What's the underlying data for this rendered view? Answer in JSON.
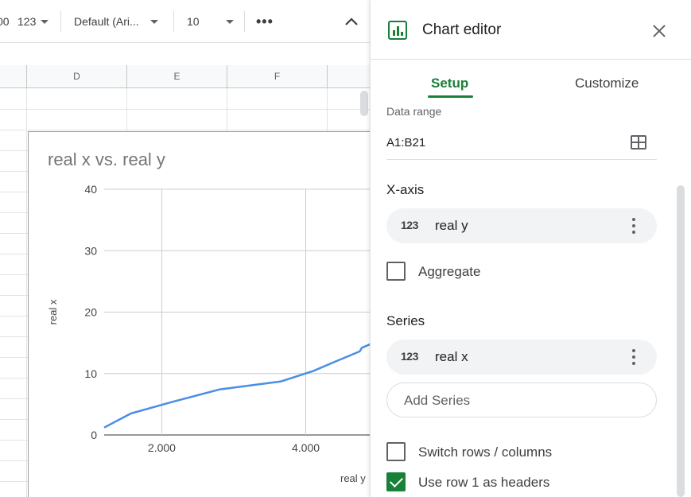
{
  "toolbar": {
    "format_partial": "00",
    "number_format": "123",
    "font": "Default (Ari...",
    "font_size": "10",
    "more_icon": "more-horizontal-icon",
    "collapse_icon": "chevron-up-icon"
  },
  "sheet": {
    "columns": [
      "D",
      "E",
      "F"
    ]
  },
  "chart_data": {
    "type": "line",
    "title": "real x vs. real y",
    "xlabel": "real y",
    "ylabel": "real x",
    "xlim": [
      1.2,
      4.9
    ],
    "ylim": [
      0,
      40
    ],
    "x_ticks": [
      "2.000",
      "4.000"
    ],
    "y_ticks": [
      "0",
      "10",
      "20",
      "30",
      "40"
    ],
    "grid": true,
    "color": "#4a8ee6",
    "series": [
      {
        "x": [
          1.2,
          1.57,
          2.15,
          2.8,
          3.65,
          4.1,
          4.4,
          4.75,
          4.78,
          4.9
        ],
        "values": [
          1.2,
          3.5,
          5.4,
          7.4,
          8.7,
          10.4,
          11.9,
          13.6,
          14.2,
          14.8
        ]
      }
    ]
  },
  "editor": {
    "title": "Chart editor",
    "tabs": {
      "setup": "Setup",
      "customize": "Customize"
    },
    "data_range": {
      "label": "Data range",
      "value": "A1:B21"
    },
    "x_axis": {
      "title": "X-axis",
      "type": "123",
      "label": "real y"
    },
    "aggregate": {
      "label": "Aggregate",
      "checked": false
    },
    "series": {
      "title": "Series",
      "type": "123",
      "label": "real x",
      "add_label": "Add Series"
    },
    "switch_rows": {
      "label": "Switch rows / columns",
      "checked": false
    },
    "use_row1": {
      "label": "Use row 1 as headers",
      "checked": true
    }
  }
}
